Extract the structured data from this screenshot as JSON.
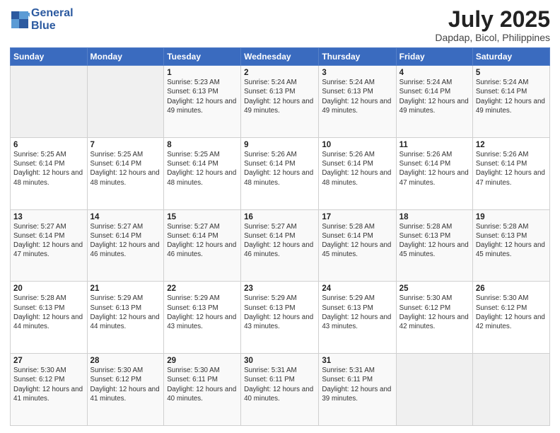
{
  "header": {
    "logo_line1": "General",
    "logo_line2": "Blue",
    "month_year": "July 2025",
    "location": "Dapdap, Bicol, Philippines"
  },
  "weekdays": [
    "Sunday",
    "Monday",
    "Tuesday",
    "Wednesday",
    "Thursday",
    "Friday",
    "Saturday"
  ],
  "weeks": [
    [
      {
        "day": "",
        "detail": ""
      },
      {
        "day": "",
        "detail": ""
      },
      {
        "day": "1",
        "detail": "Sunrise: 5:23 AM\nSunset: 6:13 PM\nDaylight: 12 hours and 49 minutes."
      },
      {
        "day": "2",
        "detail": "Sunrise: 5:24 AM\nSunset: 6:13 PM\nDaylight: 12 hours and 49 minutes."
      },
      {
        "day": "3",
        "detail": "Sunrise: 5:24 AM\nSunset: 6:13 PM\nDaylight: 12 hours and 49 minutes."
      },
      {
        "day": "4",
        "detail": "Sunrise: 5:24 AM\nSunset: 6:14 PM\nDaylight: 12 hours and 49 minutes."
      },
      {
        "day": "5",
        "detail": "Sunrise: 5:24 AM\nSunset: 6:14 PM\nDaylight: 12 hours and 49 minutes."
      }
    ],
    [
      {
        "day": "6",
        "detail": "Sunrise: 5:25 AM\nSunset: 6:14 PM\nDaylight: 12 hours and 48 minutes."
      },
      {
        "day": "7",
        "detail": "Sunrise: 5:25 AM\nSunset: 6:14 PM\nDaylight: 12 hours and 48 minutes."
      },
      {
        "day": "8",
        "detail": "Sunrise: 5:25 AM\nSunset: 6:14 PM\nDaylight: 12 hours and 48 minutes."
      },
      {
        "day": "9",
        "detail": "Sunrise: 5:26 AM\nSunset: 6:14 PM\nDaylight: 12 hours and 48 minutes."
      },
      {
        "day": "10",
        "detail": "Sunrise: 5:26 AM\nSunset: 6:14 PM\nDaylight: 12 hours and 48 minutes."
      },
      {
        "day": "11",
        "detail": "Sunrise: 5:26 AM\nSunset: 6:14 PM\nDaylight: 12 hours and 47 minutes."
      },
      {
        "day": "12",
        "detail": "Sunrise: 5:26 AM\nSunset: 6:14 PM\nDaylight: 12 hours and 47 minutes."
      }
    ],
    [
      {
        "day": "13",
        "detail": "Sunrise: 5:27 AM\nSunset: 6:14 PM\nDaylight: 12 hours and 47 minutes."
      },
      {
        "day": "14",
        "detail": "Sunrise: 5:27 AM\nSunset: 6:14 PM\nDaylight: 12 hours and 46 minutes."
      },
      {
        "day": "15",
        "detail": "Sunrise: 5:27 AM\nSunset: 6:14 PM\nDaylight: 12 hours and 46 minutes."
      },
      {
        "day": "16",
        "detail": "Sunrise: 5:27 AM\nSunset: 6:14 PM\nDaylight: 12 hours and 46 minutes."
      },
      {
        "day": "17",
        "detail": "Sunrise: 5:28 AM\nSunset: 6:14 PM\nDaylight: 12 hours and 45 minutes."
      },
      {
        "day": "18",
        "detail": "Sunrise: 5:28 AM\nSunset: 6:13 PM\nDaylight: 12 hours and 45 minutes."
      },
      {
        "day": "19",
        "detail": "Sunrise: 5:28 AM\nSunset: 6:13 PM\nDaylight: 12 hours and 45 minutes."
      }
    ],
    [
      {
        "day": "20",
        "detail": "Sunrise: 5:28 AM\nSunset: 6:13 PM\nDaylight: 12 hours and 44 minutes."
      },
      {
        "day": "21",
        "detail": "Sunrise: 5:29 AM\nSunset: 6:13 PM\nDaylight: 12 hours and 44 minutes."
      },
      {
        "day": "22",
        "detail": "Sunrise: 5:29 AM\nSunset: 6:13 PM\nDaylight: 12 hours and 43 minutes."
      },
      {
        "day": "23",
        "detail": "Sunrise: 5:29 AM\nSunset: 6:13 PM\nDaylight: 12 hours and 43 minutes."
      },
      {
        "day": "24",
        "detail": "Sunrise: 5:29 AM\nSunset: 6:13 PM\nDaylight: 12 hours and 43 minutes."
      },
      {
        "day": "25",
        "detail": "Sunrise: 5:30 AM\nSunset: 6:12 PM\nDaylight: 12 hours and 42 minutes."
      },
      {
        "day": "26",
        "detail": "Sunrise: 5:30 AM\nSunset: 6:12 PM\nDaylight: 12 hours and 42 minutes."
      }
    ],
    [
      {
        "day": "27",
        "detail": "Sunrise: 5:30 AM\nSunset: 6:12 PM\nDaylight: 12 hours and 41 minutes."
      },
      {
        "day": "28",
        "detail": "Sunrise: 5:30 AM\nSunset: 6:12 PM\nDaylight: 12 hours and 41 minutes."
      },
      {
        "day": "29",
        "detail": "Sunrise: 5:30 AM\nSunset: 6:11 PM\nDaylight: 12 hours and 40 minutes."
      },
      {
        "day": "30",
        "detail": "Sunrise: 5:31 AM\nSunset: 6:11 PM\nDaylight: 12 hours and 40 minutes."
      },
      {
        "day": "31",
        "detail": "Sunrise: 5:31 AM\nSunset: 6:11 PM\nDaylight: 12 hours and 39 minutes."
      },
      {
        "day": "",
        "detail": ""
      },
      {
        "day": "",
        "detail": ""
      }
    ]
  ]
}
